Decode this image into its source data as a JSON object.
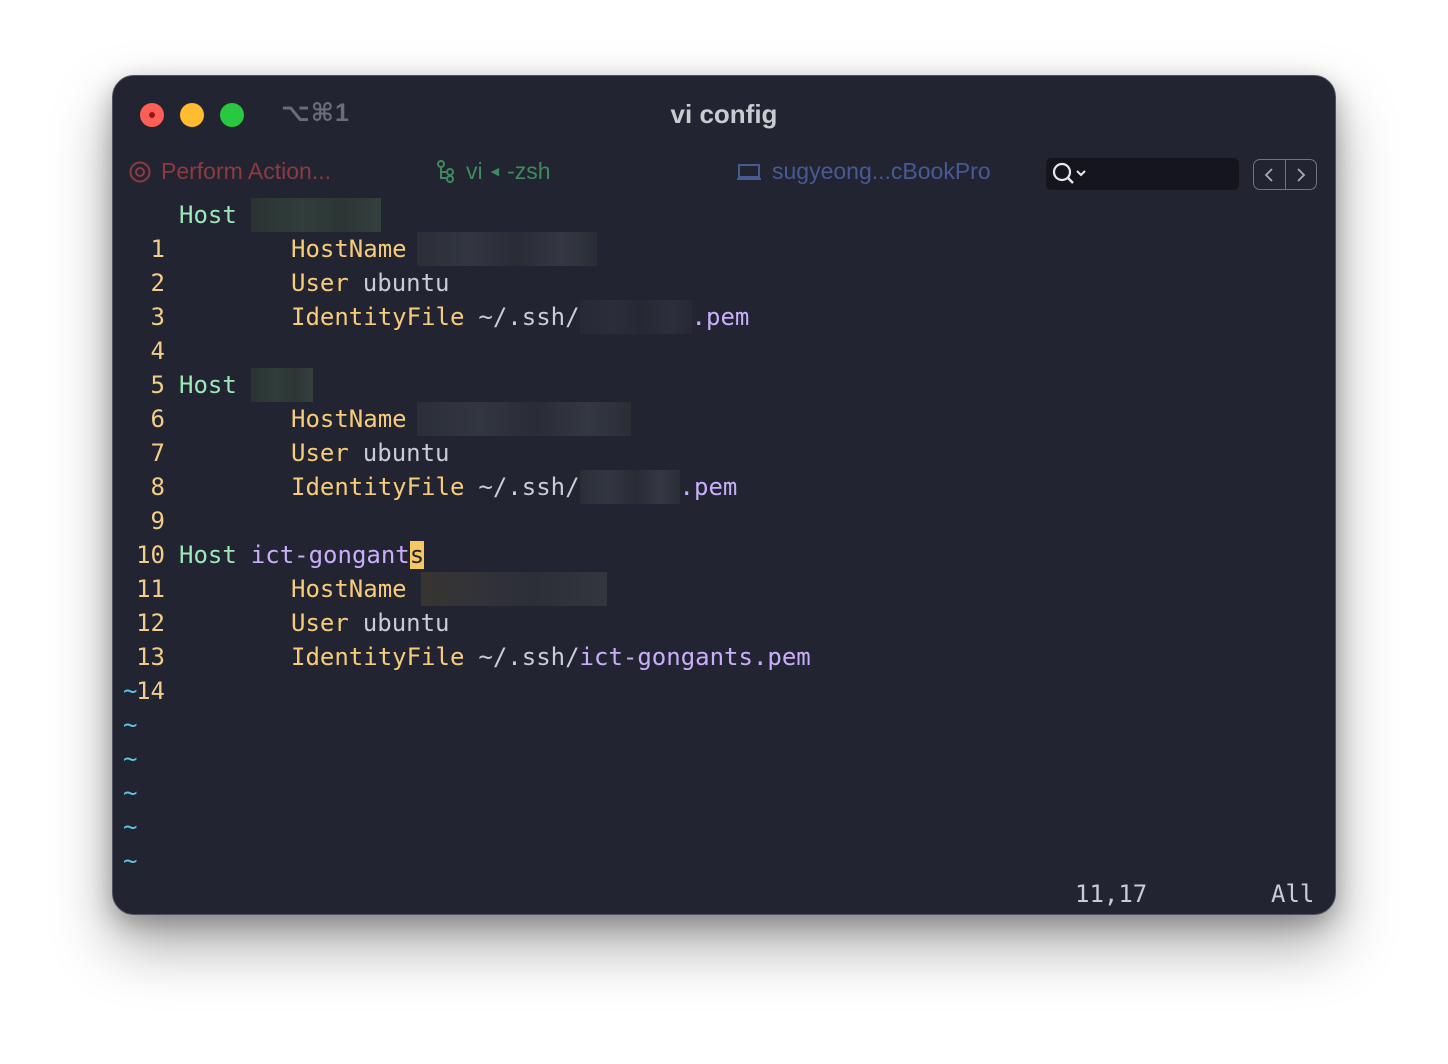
{
  "window": {
    "shortcut": "⌥⌘1",
    "title": "vi config"
  },
  "toolbar": {
    "action_label": "Perform Action...",
    "job_name": "vi",
    "job_parent": "-zsh",
    "host_label": "sugyeong...cBookPro",
    "search_value": ""
  },
  "editor": {
    "lines": [
      {
        "num": "1",
        "keyword": "Host"
      },
      {
        "num": "2",
        "field": "HostName"
      },
      {
        "num": "3",
        "field": "User",
        "value": "ubuntu"
      },
      {
        "num": "4",
        "field": "IdentityFile",
        "value": "~/.ssh/",
        "suffix": ".pem"
      },
      {
        "num": "5"
      },
      {
        "num": "6",
        "keyword": "Host"
      },
      {
        "num": "7",
        "field": "HostName"
      },
      {
        "num": "8",
        "field": "User",
        "value": "ubuntu"
      },
      {
        "num": "9",
        "field": "IdentityFile",
        "value": "~/.ssh/",
        "suffix": ".pem"
      },
      {
        "num": "10"
      },
      {
        "num": "11",
        "keyword": "Host",
        "value": "ict-gongant",
        "cursor_char": "s"
      },
      {
        "num": "12",
        "field": "HostName"
      },
      {
        "num": "13",
        "field": "User",
        "value": "ubuntu"
      },
      {
        "num": "14",
        "field": "IdentityFile",
        "value": "~/.ssh/",
        "suffix": "ict-gongants.pem"
      }
    ],
    "tilde": "~"
  },
  "status": {
    "position": "11,17",
    "scroll": "All"
  },
  "colors": {
    "background": "#222432",
    "line_number": "#f2cd8a",
    "host_keyword": "#9be8b8",
    "field_keyword": "#f7cc79",
    "path_purple": "#c9aefa",
    "cursor": "#f6c862",
    "tilde": "#5ac4e4"
  }
}
